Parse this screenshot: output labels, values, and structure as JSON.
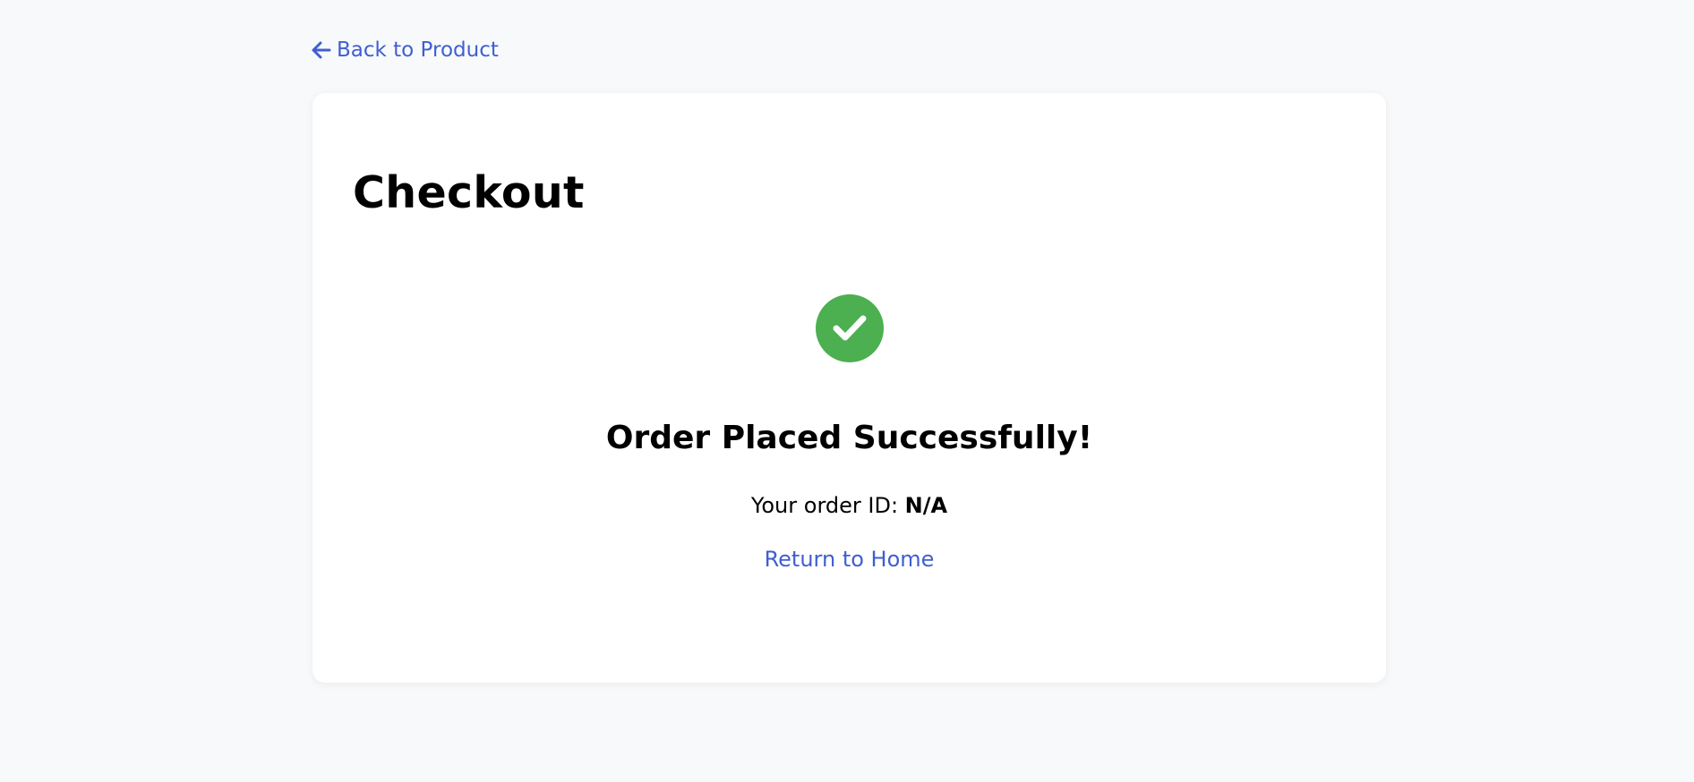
{
  "nav": {
    "back_label": "Back to Product",
    "back_icon": "arrow-left-icon"
  },
  "checkout": {
    "title": "Checkout",
    "success_icon": "check-circle-icon",
    "success_heading": "Order Placed Successfully!",
    "order_id_label": "Your order ID:",
    "order_id_value": "N/A",
    "return_label": "Return to Home"
  },
  "colors": {
    "page_background": "#f8f9fb",
    "card_background": "#ffffff",
    "link": "#3f5fd0",
    "success": "#4caf50",
    "text": "#000000"
  }
}
